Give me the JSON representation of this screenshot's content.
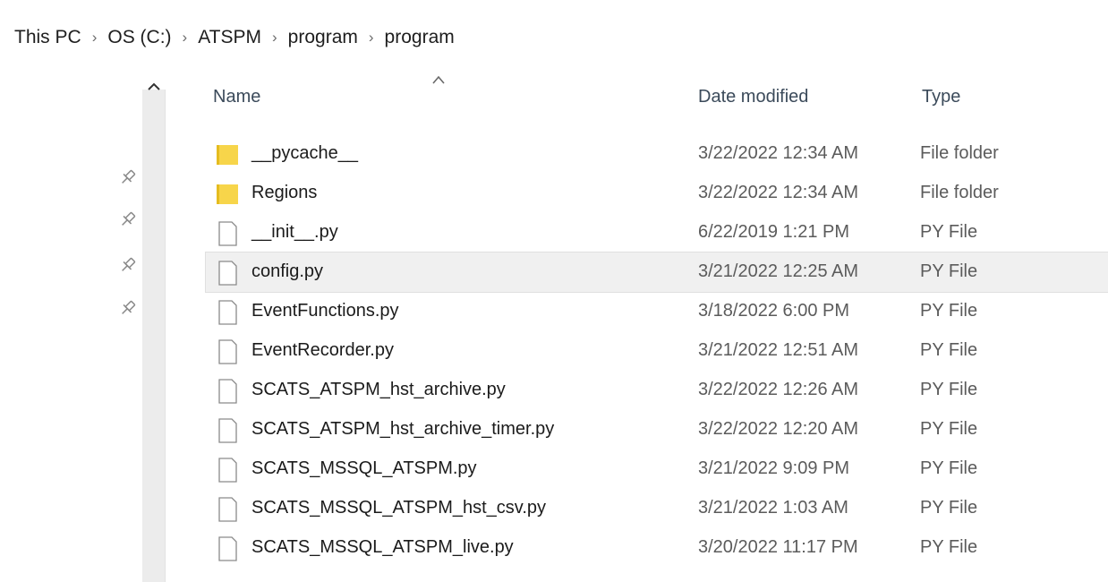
{
  "breadcrumb": {
    "items": [
      "This PC",
      "OS (C:)",
      "ATSPM",
      "program",
      "program"
    ],
    "separator": "›"
  },
  "columns": {
    "name": "Name",
    "date": "Date modified",
    "type": "Type"
  },
  "sort": {
    "column": "Name",
    "direction": "ascending"
  },
  "colors": {
    "folder": "#f7d54a",
    "folder_dark": "#e5bc20",
    "file_icon_stroke": "#8a8a8a",
    "selected_row": "#f0f0f0"
  },
  "files": [
    {
      "name": "__pycache__",
      "date": "3/22/2022 12:34 AM",
      "type": "File folder",
      "icon": "folder-icon"
    },
    {
      "name": "Regions",
      "date": "3/22/2022 12:34 AM",
      "type": "File folder",
      "icon": "folder-icon"
    },
    {
      "name": "__init__.py",
      "date": "6/22/2019 1:21 PM",
      "type": "PY File",
      "icon": "file-icon"
    },
    {
      "name": "config.py",
      "date": "3/21/2022 12:25 AM",
      "type": "PY File",
      "icon": "file-icon",
      "selected": true
    },
    {
      "name": "EventFunctions.py",
      "date": "3/18/2022 6:00 PM",
      "type": "PY File",
      "icon": "file-icon"
    },
    {
      "name": "EventRecorder.py",
      "date": "3/21/2022 12:51 AM",
      "type": "PY File",
      "icon": "file-icon"
    },
    {
      "name": "SCATS_ATSPM_hst_archive.py",
      "date": "3/22/2022 12:26 AM",
      "type": "PY File",
      "icon": "file-icon"
    },
    {
      "name": "SCATS_ATSPM_hst_archive_timer.py",
      "date": "3/22/2022 12:20 AM",
      "type": "PY File",
      "icon": "file-icon"
    },
    {
      "name": "SCATS_MSSQL_ATSPM.py",
      "date": "3/21/2022 9:09 PM",
      "type": "PY File",
      "icon": "file-icon"
    },
    {
      "name": "SCATS_MSSQL_ATSPM_hst_csv.py",
      "date": "3/21/2022 1:03 AM",
      "type": "PY File",
      "icon": "file-icon"
    },
    {
      "name": "SCATS_MSSQL_ATSPM_live.py",
      "date": "3/20/2022 11:17 PM",
      "type": "PY File",
      "icon": "file-icon"
    }
  ]
}
